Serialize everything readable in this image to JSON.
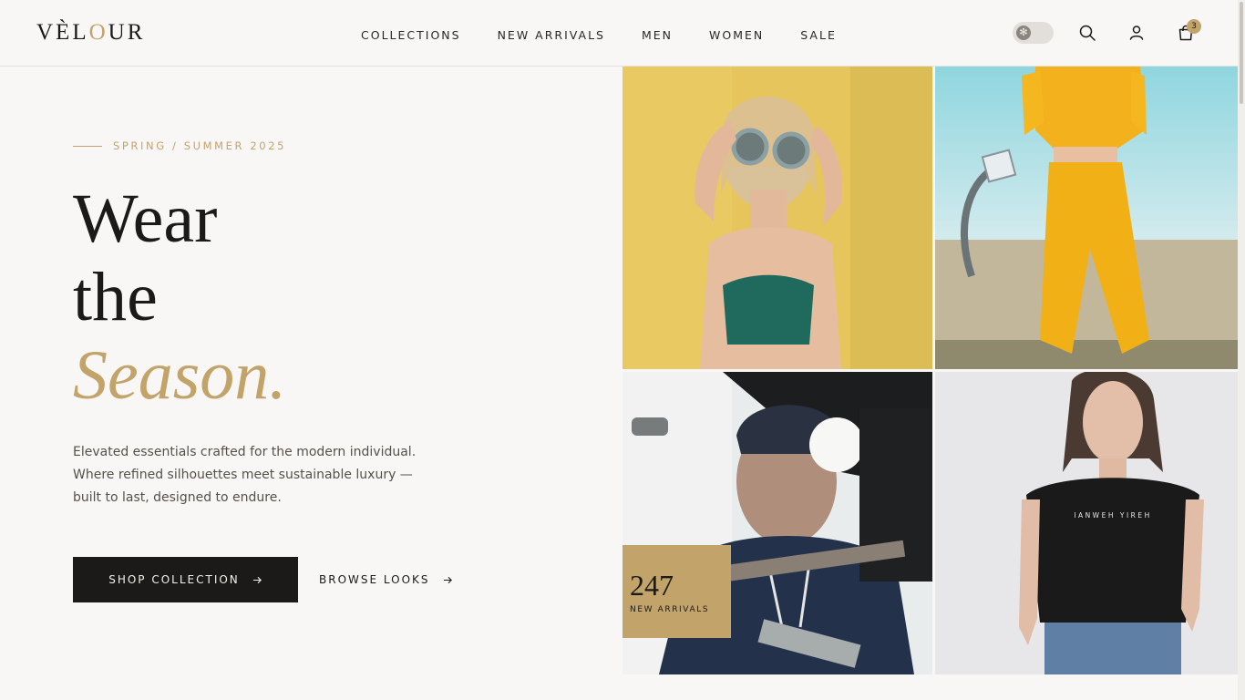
{
  "brand": {
    "prefix": "VÈL",
    "accent": "O",
    "suffix": "UR"
  },
  "nav": [
    "COLLECTIONS",
    "NEW ARRIVALS",
    "MEN",
    "WOMEN",
    "SALE"
  ],
  "header": {
    "cart_count": "3",
    "theme_toggle_icon": "✻"
  },
  "hero": {
    "eyebrow": "SPRING / SUMMER 2025",
    "headline_line1": "Wear",
    "headline_line2": "the",
    "headline_accent": "Season.",
    "description": "Elevated essentials crafted for the modern individual. Where refined silhouettes meet sustainable luxury — built to last, designed to endure.",
    "primary_cta": "SHOP COLLECTION",
    "secondary_cta": "BROWSE LOOKS"
  },
  "stat": {
    "value": "247",
    "label": "NEW ARRIVALS"
  },
  "tshirt_print": "IANWEH YIREH",
  "colors": {
    "accent": "#c2a36a",
    "dark": "#1c1a18",
    "background": "#f9f7f5"
  }
}
